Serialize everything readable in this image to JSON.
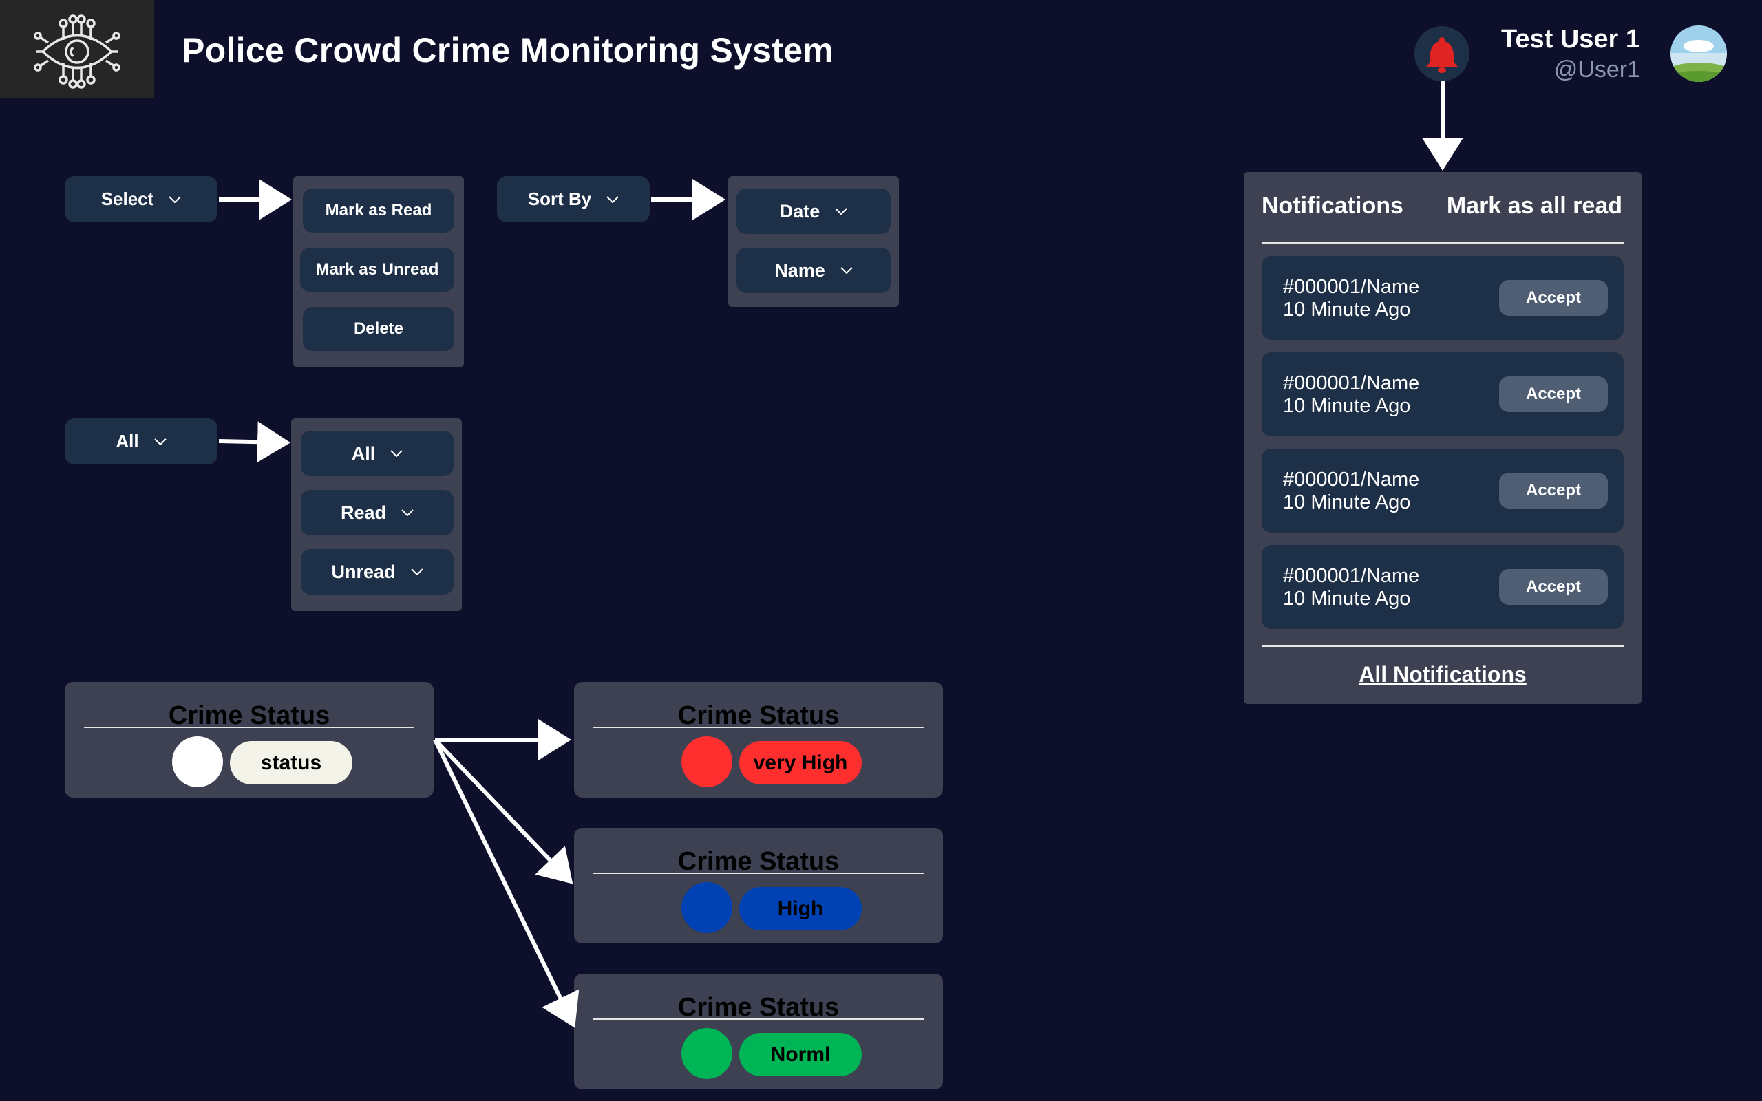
{
  "header": {
    "title": "Police Crowd Crime Monitoring System",
    "user_name": "Test User 1",
    "user_handle": "@User1",
    "logo_icon": "eye-circuit-icon",
    "bell_icon": "bell-icon",
    "bell_color": "#e02424"
  },
  "select_menu": {
    "label": "Select",
    "options": [
      "Mark as Read",
      "Mark as Unread",
      "Delete"
    ]
  },
  "sort_menu": {
    "label": "Sort By",
    "options": [
      "Date",
      "Name"
    ]
  },
  "filter_menu": {
    "label": "All",
    "options": [
      "All",
      "Read",
      "Unread"
    ]
  },
  "crime_status": {
    "source": {
      "title": "Crime Status",
      "label": "status",
      "color": "#ffffff",
      "pill_color": "#f4f3ea"
    },
    "levels": [
      {
        "title": "Crime Status",
        "label": "very High",
        "color": "#ff2f2f"
      },
      {
        "title": "Crime Status",
        "label": "High",
        "color": "#0041b3"
      },
      {
        "title": "Crime Status",
        "label": "Norml",
        "color": "#00b556"
      }
    ]
  },
  "notifications": {
    "title": "Notifications",
    "mark_all": "Mark as all read",
    "items": [
      {
        "id": "#000001/Name",
        "time": "10 Minute Ago",
        "action": "Accept"
      },
      {
        "id": "#000001/Name",
        "time": "10 Minute Ago",
        "action": "Accept"
      },
      {
        "id": "#000001/Name",
        "time": "10 Minute Ago",
        "action": "Accept"
      },
      {
        "id": "#000001/Name",
        "time": "10 Minute Ago",
        "action": "Accept"
      }
    ],
    "footer_link": "All Notifications"
  },
  "colors": {
    "background": "#0d0f2b",
    "button": "#1e3047",
    "panel": "#3e4152"
  }
}
